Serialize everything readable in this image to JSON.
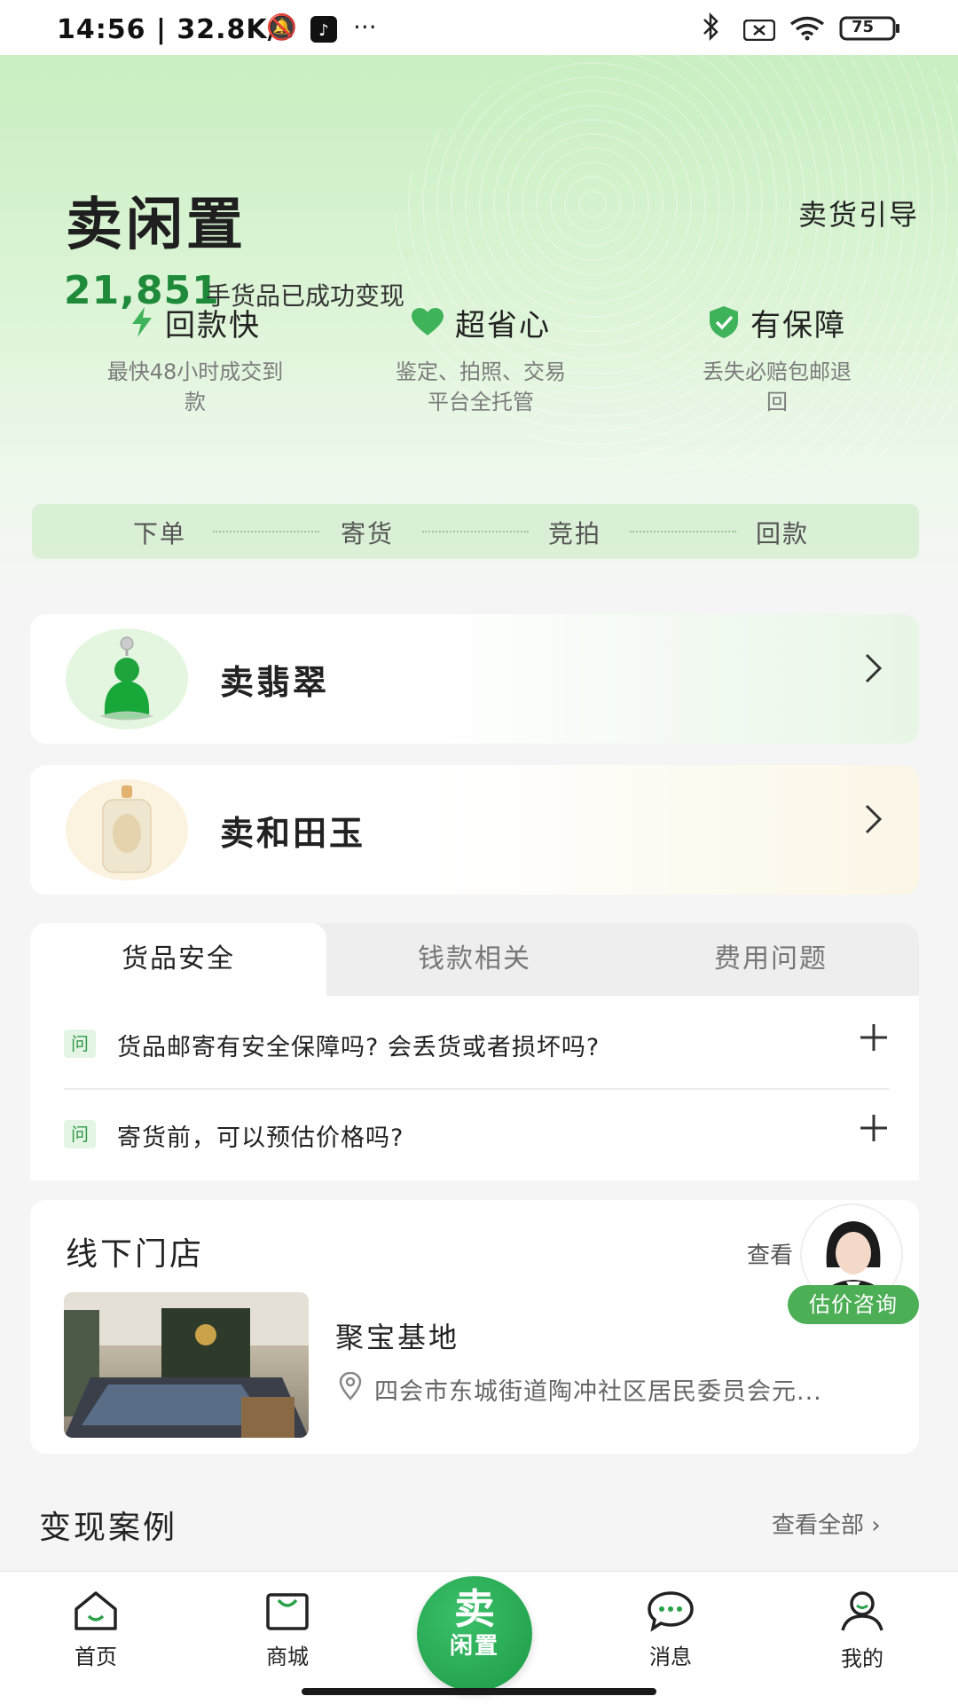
{
  "status_bar": {
    "time": "14:56 | 32.8K/s",
    "battery": "75"
  },
  "hero": {
    "title": "卖闲置",
    "guide": "卖货引导",
    "count": "21,851",
    "count_text": "手货品已成功变现",
    "features": [
      {
        "title": "回款快",
        "desc": "最快48小时成交到款",
        "icon": "lightning-icon"
      },
      {
        "title": "超省心",
        "desc": "鉴定、拍照、交易平台全托管",
        "icon": "heart-icon"
      },
      {
        "title": "有保障",
        "desc": "丢失必赔包邮退回",
        "icon": "shield-check-icon"
      }
    ],
    "flow": [
      "下单",
      "寄货",
      "竞拍",
      "回款"
    ]
  },
  "categories": [
    {
      "label": "卖翡翠"
    },
    {
      "label": "卖和田玉"
    }
  ],
  "faq": {
    "tabs": [
      "货品安全",
      "钱款相关",
      "费用问题"
    ],
    "active_tab": 0,
    "badge": "问",
    "items": [
      {
        "q": "货品邮寄有安全保障吗? 会丢货或者损坏吗?"
      },
      {
        "q": "寄货前，可以预估价格吗?"
      }
    ]
  },
  "stores": {
    "title": "线下门店",
    "more": "查看",
    "store_name": "聚宝基地",
    "address": "四会市东城街道陶冲社区居民委员会元..."
  },
  "consultant": {
    "label": "估价咨询"
  },
  "cases": {
    "title": "变现案例",
    "more": "查看全部 ›"
  },
  "tab_bar": {
    "items": [
      {
        "label": "首页",
        "icon": "home-icon"
      },
      {
        "label": "商城",
        "icon": "mall-icon"
      },
      {
        "label": "消息",
        "icon": "message-icon"
      },
      {
        "label": "我的",
        "icon": "profile-icon"
      }
    ],
    "center_big": "卖",
    "center_small": "闲置"
  },
  "colors": {
    "accent_green": "#1e8a3a",
    "button_green": "#4cae55"
  }
}
